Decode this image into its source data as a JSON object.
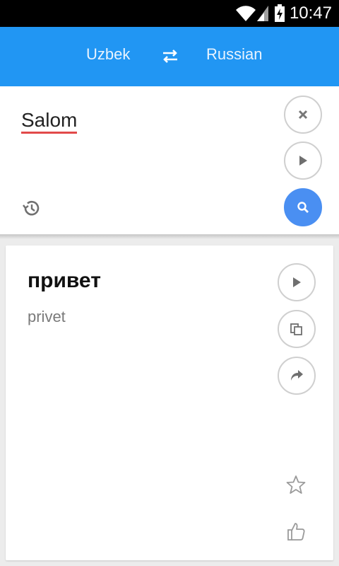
{
  "status_bar": {
    "time": "10:47",
    "icons": [
      "wifi-icon",
      "signal-icon",
      "battery-charging-icon"
    ]
  },
  "app_bar": {
    "source_language": "Uzbek",
    "target_language": "Russian",
    "swap_icon": "swap-arrows-icon"
  },
  "input": {
    "text": "Salom",
    "buttons": [
      "close-icon",
      "play-icon",
      "search-icon"
    ],
    "history_icon": "history-icon"
  },
  "result": {
    "translation": "привет",
    "transliteration": "privet",
    "buttons": [
      "play-icon",
      "copy-icon",
      "share-icon",
      "star-icon",
      "thumbs-up-icon"
    ]
  },
  "colors": {
    "app_bar": "#2196f3",
    "search_button": "#4a8ff2",
    "spellcheck_underline": "#e24a4a"
  }
}
